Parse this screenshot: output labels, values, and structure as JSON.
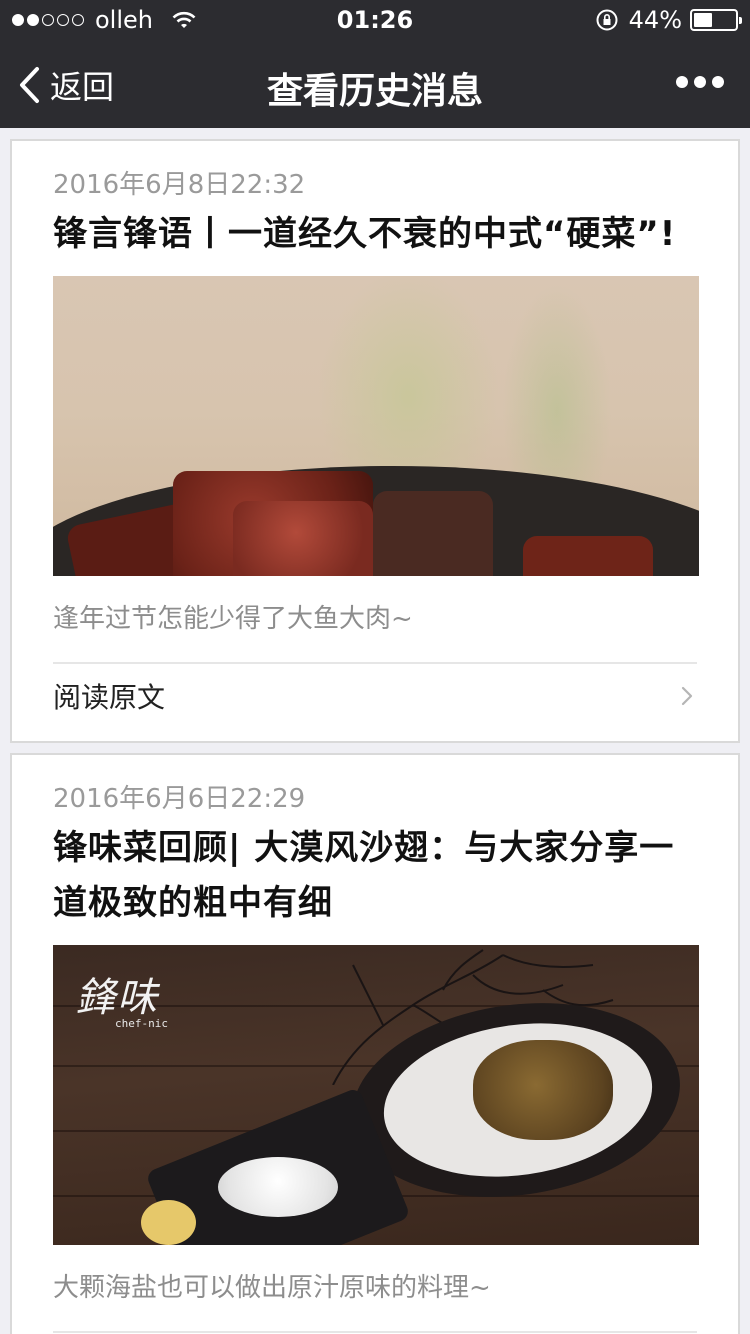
{
  "status_bar": {
    "carrier": "olleh",
    "time": "01:26",
    "battery_text": "44%",
    "battery_level": 0.44,
    "signal_strength": 2
  },
  "nav": {
    "back_label": "返回",
    "title": "查看历史消息",
    "more_icon": "more-dots-icon"
  },
  "articles": [
    {
      "date": "2016年6月8日22:32",
      "title": "锋言锋语丨一道经久不衰的中式“硬菜”!",
      "digest": "逢年过节怎能少得了大鱼大肉~",
      "read_more": "阅读原文"
    },
    {
      "date": "2016年6月6日22:29",
      "title": "锋味菜回顾| 大漠风沙翅：与大家分享一道极致的粗中有细",
      "digest": "大颗海盐也可以做出原汁原味的料理~",
      "image_logo": "鋒味",
      "image_logo_sub": "chef-nic"
    }
  ],
  "colors": {
    "bar_bg": "#2c2c30",
    "page_bg": "#efeff4",
    "date_text": "#9a9a9a",
    "digest_text": "#8d8d8d"
  }
}
